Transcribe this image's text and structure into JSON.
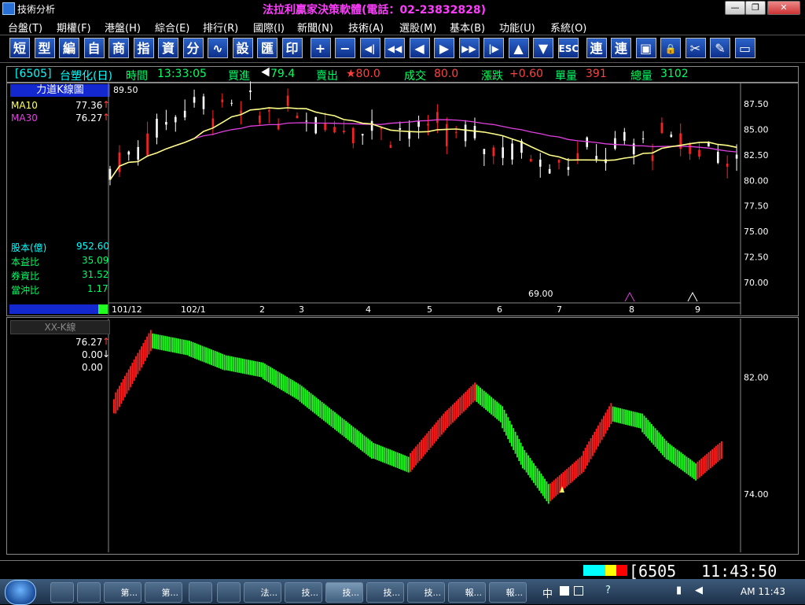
{
  "window": {
    "title": "技術分析",
    "banner": "法拉利贏家決策軟體(電話：02-23832828)",
    "controls": {
      "minimize": "—",
      "restore": "❐",
      "close": "✕"
    }
  },
  "menu": [
    "台盤(T)",
    "期權(F)",
    "港盤(H)",
    "綜合(E)",
    "排行(R)",
    "國際(I)",
    "新聞(N)",
    "技術(A)",
    "選股(M)",
    "基本(B)",
    "功能(U)",
    "系統(O)"
  ],
  "toolbar": [
    {
      "name": "short",
      "label": "短"
    },
    {
      "name": "pattern",
      "label": "型"
    },
    {
      "name": "edit",
      "label": "編"
    },
    {
      "name": "self",
      "label": "自"
    },
    {
      "name": "product",
      "label": "商"
    },
    {
      "name": "index",
      "label": "指"
    },
    {
      "name": "capital",
      "label": "資"
    },
    {
      "name": "split",
      "label": "分"
    },
    {
      "name": "chart",
      "label": "∿"
    },
    {
      "name": "settings",
      "label": "設"
    },
    {
      "name": "export",
      "label": "匯"
    },
    {
      "name": "print",
      "label": "印"
    },
    {
      "name": "plus",
      "label": "+"
    },
    {
      "name": "minus",
      "label": "−"
    },
    {
      "name": "first",
      "label": "◀|"
    },
    {
      "name": "rewind",
      "label": "◀◀"
    },
    {
      "name": "prev",
      "label": "◀"
    },
    {
      "name": "next",
      "label": "▶"
    },
    {
      "name": "forward",
      "label": "▶▶"
    },
    {
      "name": "last",
      "label": "|▶"
    },
    {
      "name": "up",
      "label": "▲"
    },
    {
      "name": "down",
      "label": "▼"
    },
    {
      "name": "esc",
      "label": "ESC"
    },
    {
      "name": "link1",
      "label": "連"
    },
    {
      "name": "link2",
      "label": "連"
    },
    {
      "name": "window",
      "label": "▣"
    },
    {
      "name": "lock",
      "label": "🔒"
    },
    {
      "name": "tools",
      "label": "✂"
    },
    {
      "name": "pen",
      "label": "✎"
    },
    {
      "name": "frame",
      "label": "▭"
    }
  ],
  "quote": {
    "code": "[6505]",
    "name": "台塑化(日)",
    "time_label": "時間",
    "time": "13:33:05",
    "buy_label": "買進",
    "buy": "79.4",
    "sell_label": "賣出",
    "sell": "★80.0",
    "deal_label": "成交",
    "deal": "80.0",
    "change_label": "漲跌",
    "change": "+0.60",
    "vol_label": "單量",
    "vol": "391",
    "total_label": "總量",
    "total": "3102"
  },
  "upper": {
    "panel_title": "力道K線圖",
    "ma": [
      {
        "name": "MA10",
        "value": "77.36",
        "arrow": "↑",
        "color": "#ffff66"
      },
      {
        "name": "MA30",
        "value": "76.27",
        "arrow": "↑",
        "color": "#e040e0"
      }
    ],
    "stats": [
      {
        "label": "股本(億)",
        "value": "952.60"
      },
      {
        "label": "本益比",
        "value": "35.09"
      },
      {
        "label": "券資比",
        "value": "31.52"
      },
      {
        "label": "當沖比",
        "value": "1.17"
      }
    ],
    "high_label": "89.50",
    "low_label": "69.00",
    "y_ticks": [
      "87.50",
      "85.00",
      "82.50",
      "80.00",
      "77.50",
      "75.00",
      "72.50",
      "70.00"
    ],
    "x_ticks": [
      "101/12",
      "102/1",
      "2",
      "3",
      "4",
      "5",
      "6",
      "7",
      "8",
      "9"
    ]
  },
  "lower": {
    "panel_title": "XX-K線",
    "values": [
      "76.27",
      "0.00",
      "0.00"
    ],
    "arrows": [
      "↑",
      "↓",
      ""
    ],
    "y_ticks": [
      "82.00",
      "74.00"
    ]
  },
  "status": {
    "code": "[6505_",
    "time": "11:43:50",
    "colors": [
      "#00ffff",
      "#00ffff",
      "#ffff00",
      "#ff0000"
    ]
  },
  "taskbar": {
    "items": [
      {
        "name": "folder",
        "label": ""
      },
      {
        "name": "media",
        "label": ""
      },
      {
        "name": "word1",
        "label": "第..."
      },
      {
        "name": "word2",
        "label": "第..."
      },
      {
        "name": "chrome",
        "label": ""
      },
      {
        "name": "ie",
        "label": ""
      },
      {
        "name": "app1",
        "label": "法..."
      },
      {
        "name": "app2",
        "label": "技..."
      },
      {
        "name": "app3",
        "label": "技..."
      },
      {
        "name": "app4",
        "label": "技..."
      },
      {
        "name": "app5",
        "label": "技..."
      },
      {
        "name": "app6",
        "label": "報..."
      },
      {
        "name": "app7",
        "label": "報..."
      }
    ],
    "ime": "中",
    "clock": "AM 11:43"
  },
  "chart_data": [
    {
      "type": "candlestick",
      "title": "力道K線圖",
      "series": [
        {
          "name": "MA10",
          "color": "#ffff66"
        },
        {
          "name": "MA30",
          "color": "#e040e0"
        }
      ],
      "ylim": [
        68,
        89.5
      ],
      "y_ticks": [
        70,
        72.5,
        75,
        77.5,
        80,
        82.5,
        85,
        87.5
      ],
      "x_ticks": [
        "101/12",
        "102/1",
        "2",
        "3",
        "4",
        "5",
        "6",
        "7",
        "8",
        "9"
      ],
      "high": 89.5,
      "low": 69.0,
      "last": {
        "MA10": 77.36,
        "MA30": 76.27
      }
    },
    {
      "type": "bar",
      "title": "XX-K線",
      "ylim": [
        70,
        86
      ],
      "y_ticks": [
        74,
        82
      ],
      "colors": {
        "up": "#ff2020",
        "down": "#20ff20"
      }
    }
  ]
}
